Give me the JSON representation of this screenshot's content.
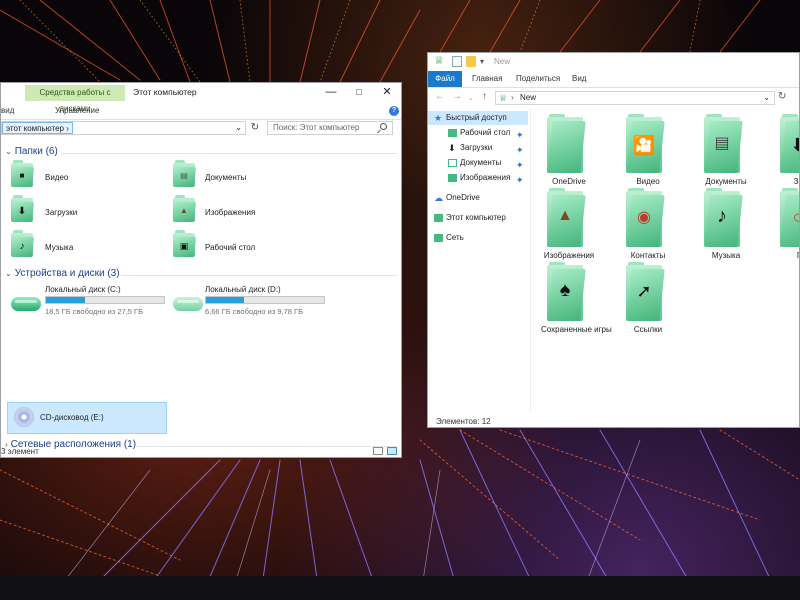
{
  "left_window": {
    "context_tab": "Средства работы с дисками",
    "title": "Этот компьютер",
    "ribbon_tabs": [
      "вид",
      "Управление"
    ],
    "breadcrumb": "этот компьютер",
    "search_placeholder": "Поиск: Этот компьютер",
    "groups": {
      "folders": "Папки (6)",
      "devices": "Устройства и диски (3)",
      "network": "Сетевые расположения (1)"
    },
    "folders": [
      {
        "name": "Видео",
        "icon": "video-folder-icon"
      },
      {
        "name": "Документы",
        "icon": "documents-folder-icon"
      },
      {
        "name": "Загрузки",
        "icon": "downloads-folder-icon"
      },
      {
        "name": "Изображения",
        "icon": "pictures-folder-icon"
      },
      {
        "name": "Музыка",
        "icon": "music-folder-icon"
      },
      {
        "name": "Рабочий стол",
        "icon": "desktop-folder-icon"
      }
    ],
    "drives": [
      {
        "name": "Локальный диск (C:)",
        "free": "18,5 ГБ свободно из 27,5 ГБ",
        "used_fraction": 0.33
      },
      {
        "name": "Локальный диск (D:)",
        "free": "6,66 ГБ свободно из 9,78 ГБ",
        "used_fraction": 0.32
      }
    ],
    "cd_drive": "CD-дисковод (E:)",
    "status": "3 элемент"
  },
  "right_window": {
    "title": "New",
    "ribbon_tabs": [
      "Файл",
      "Главная",
      "Поделиться",
      "Вид"
    ],
    "address": "New",
    "sidebar": [
      {
        "label": "Быстрый доступ",
        "icon": "star-icon"
      },
      {
        "label": "Рабочий стол",
        "icon": "desktop-icon",
        "pinned": true
      },
      {
        "label": "Загрузки",
        "icon": "download-icon",
        "pinned": true
      },
      {
        "label": "Документы",
        "icon": "document-icon",
        "pinned": true
      },
      {
        "label": "Изображения",
        "icon": "pictures-icon",
        "pinned": true
      },
      {
        "label": "OneDrive",
        "icon": "cloud-icon"
      },
      {
        "label": "Этот компьютер",
        "icon": "computer-icon"
      },
      {
        "label": "Сеть",
        "icon": "network-icon"
      }
    ],
    "items": [
      {
        "name": "OneDrive"
      },
      {
        "name": "Видео"
      },
      {
        "name": "Документы"
      },
      {
        "name": "Загр"
      },
      {
        "name": "Изображения"
      },
      {
        "name": "Контакты"
      },
      {
        "name": "Музыка"
      },
      {
        "name": "По"
      },
      {
        "name": "Сохраненные игры"
      },
      {
        "name": "Ссылки"
      }
    ],
    "status": "Элементов: 12"
  },
  "colors": {
    "accent": "#1979ca",
    "folder_green": "#58c98e",
    "selection": "#cce8ff",
    "progress": "#26a0da"
  }
}
